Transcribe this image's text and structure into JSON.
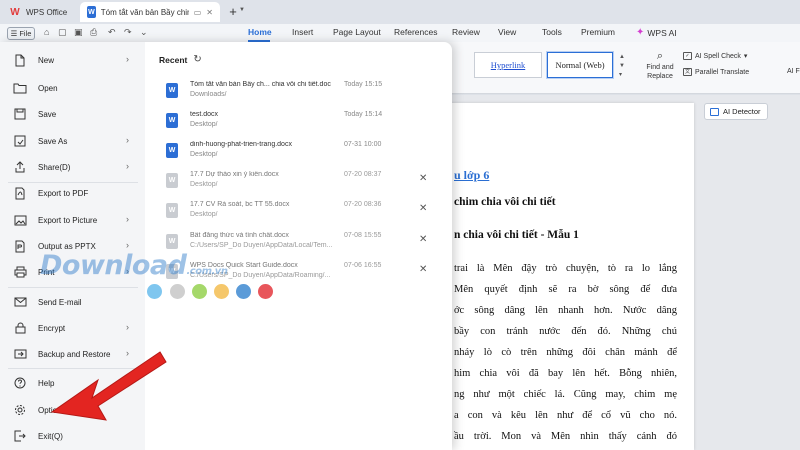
{
  "titlebar": {
    "tabs": [
      {
        "label": "WPS Office",
        "icon": "wps-logo-icon"
      },
      {
        "label": "Tóm tắt văn bản Bầy chim ch...",
        "icon": "doc-icon"
      }
    ],
    "new_tab": "+"
  },
  "menubar": {
    "file_label": "File",
    "tabs": [
      "Home",
      "Insert",
      "Page Layout",
      "References",
      "Review",
      "View",
      "Tools",
      "Premium"
    ],
    "active_tab": "Home",
    "wps_ai": "WPS AI"
  },
  "ribbon": {
    "style_hyperlink": "Hyperlink",
    "style_normal": "Normal (Web)",
    "find_replace": "Find and Replace",
    "ai_spell_check": "AI Spell Check",
    "parallel_translate": "Parallel Translate",
    "ai_font": "AI F",
    "ai_detector": "AI Detector"
  },
  "file_menu": {
    "items": [
      {
        "label": "New",
        "icon": "new-icon",
        "chevron": true
      },
      {
        "label": "Open",
        "icon": "open-icon",
        "chevron": false
      },
      {
        "label": "Save",
        "icon": "save-icon",
        "chevron": false
      },
      {
        "label": "Save As",
        "icon": "save-as-icon",
        "chevron": true
      },
      {
        "label": "Share(D)",
        "icon": "share-icon",
        "chevron": true
      },
      {
        "label": "Export to PDF",
        "icon": "pdf-icon",
        "chevron": false
      },
      {
        "label": "Export to Picture",
        "icon": "picture-icon",
        "chevron": true
      },
      {
        "label": "Output as PPTX",
        "icon": "pptx-icon",
        "chevron": true
      },
      {
        "label": "Print",
        "icon": "print-icon",
        "chevron": true
      },
      {
        "label": "Send E-mail",
        "icon": "email-icon",
        "chevron": false
      },
      {
        "label": "Encrypt",
        "icon": "lock-icon",
        "chevron": true
      },
      {
        "label": "Backup and Restore",
        "icon": "backup-icon",
        "chevron": true
      },
      {
        "label": "Help",
        "icon": "help-icon",
        "chevron": true
      },
      {
        "label": "Options(L)",
        "icon": "gear-icon",
        "chevron": false
      },
      {
        "label": "Exit(Q)",
        "icon": "exit-icon",
        "chevron": false
      }
    ]
  },
  "recent": {
    "title": "Recent",
    "files": [
      {
        "name": "Tóm tắt văn bản Bầy ch... chia vôi chi tiết.doc",
        "path": "Downloads/",
        "time": "Today 15:15",
        "kind": "blue",
        "removable": false,
        "dim": false
      },
      {
        "name": "test.docx",
        "path": "Desktop/",
        "time": "Today 15:14",
        "kind": "blue",
        "removable": false,
        "dim": false
      },
      {
        "name": "dinh-huong-phat-trien-trang.docx",
        "path": "Desktop/",
        "time": "07-31 10:00",
        "kind": "blue",
        "removable": false,
        "dim": false
      },
      {
        "name": "17.7 Dự thảo xin ý kiến.docx",
        "path": "Desktop/",
        "time": "07-20 08:37",
        "kind": "gray",
        "removable": true,
        "dim": true
      },
      {
        "name": "17.7 CV Rà soát, bc TT 55.docx",
        "path": "Desktop/",
        "time": "07-20 08:36",
        "kind": "gray",
        "removable": true,
        "dim": true
      },
      {
        "name": "Bất đẳng thức và tính chất.docx",
        "path": "C:/Users/SP_Do Duyen/AppData/Local/Tem...",
        "time": "07-08 15:55",
        "kind": "gray",
        "removable": true,
        "dim": true
      },
      {
        "name": "WPS Docs Quick Start Guide.docx",
        "path": "C:/Users/SP_Do Duyen/AppData/Roaming/...",
        "time": "07-06 16:55",
        "kind": "gray",
        "removable": true,
        "dim": true
      }
    ]
  },
  "document": {
    "heading1": "u lớp 6",
    "heading2": "chim chia vôi chi tiết",
    "heading3": "n chia vôi chi tiết - Mẫu 1",
    "lines": [
      "trai là Mên đậy trò chuyện, tò ra lo lắng",
      "Mên quyết định sẽ ra bờ sông để đưa",
      "ớc sông dâng lên nhanh hơn. Nước dâng",
      "bầy con tránh nước đến đó. Những chú",
      "nháy lò cò trên những đôi chân mảnh để",
      "him chia vôi đã bay lên hết. Bỗng nhiên,",
      "ng như một chiếc lá. Cũng may, chim mẹ",
      "a con và kêu lên như để cổ vũ cho nó.",
      "ầu trời. Mon và Mên nhìn thấy cảnh đó"
    ]
  },
  "watermark": {
    "text": "Download",
    "suffix": ".com.vn"
  },
  "colors": {
    "accent": "#2b6fd6",
    "arrow": "#e32521",
    "wm_dots": [
      "#7fc6ef",
      "#cfcfcf",
      "#a5d86a",
      "#f5c76b",
      "#5b9bd8",
      "#e8565b"
    ]
  }
}
